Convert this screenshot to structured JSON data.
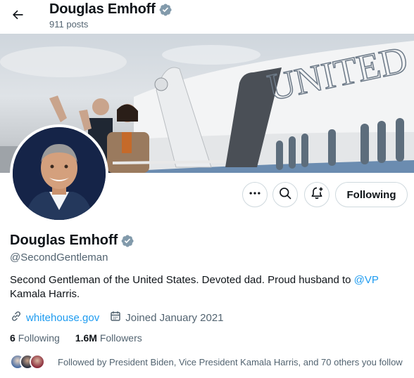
{
  "header": {
    "back_icon": "arrow-left-icon",
    "name": "Douglas Emhoff",
    "posts_count": "911 posts",
    "verified_icon": "verified-badge-icon",
    "verified_color": "#829aab"
  },
  "actions": {
    "more_icon": "ellipsis-icon",
    "search_icon": "search-icon",
    "notify_icon": "bell-plus-icon",
    "following_label": "Following"
  },
  "profile": {
    "display_name": "Douglas Emhoff",
    "handle": "@SecondGentleman",
    "bio_text": "Second Gentleman of the United States. Devoted dad. Proud husband to ",
    "bio_mention": "@VP",
    "bio_suffix": " Kamala Harris.",
    "website": "whitehouse.gov",
    "joined": "Joined January 2021",
    "link_icon": "link-icon",
    "calendar_icon": "calendar-icon"
  },
  "stats": {
    "following_count": "6",
    "following_label": "Following",
    "followers_count": "1.6M",
    "followers_label": "Followers"
  },
  "followed_by": {
    "text": "Followed by President Biden, Vice President Kamala Harris, and 70 others you follow"
  },
  "banner": {
    "plane_text": "UNITED"
  },
  "colors": {
    "accent": "#1d9bf0",
    "text": "#0f1419",
    "secondary": "#536471",
    "border": "#cfd9de"
  }
}
